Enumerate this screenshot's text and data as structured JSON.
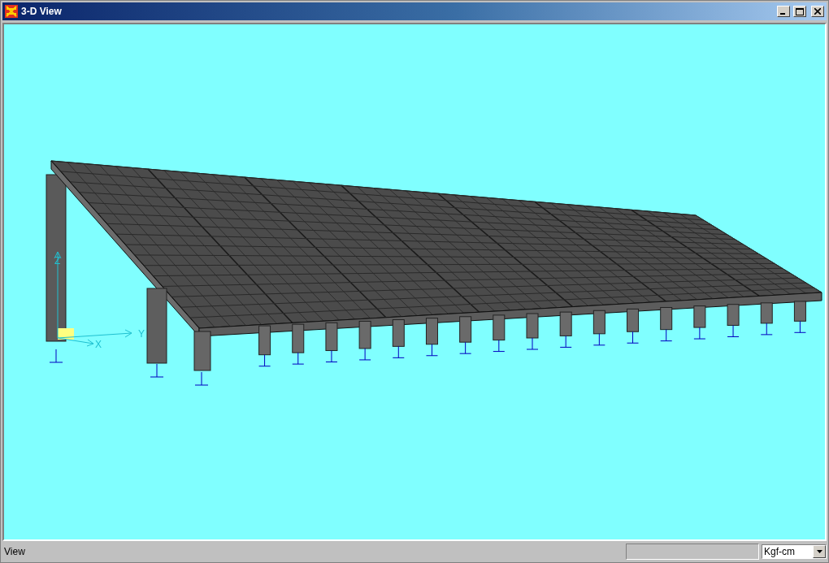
{
  "window": {
    "title": "3-D View"
  },
  "viewport": {
    "axes": [
      {
        "kind": "z",
        "label": "Z"
      },
      {
        "kind": "x",
        "label": "X"
      },
      {
        "kind": "y",
        "label": "Y"
      }
    ]
  },
  "status_bar": {
    "message": "View",
    "units": "Kgf-cm"
  }
}
